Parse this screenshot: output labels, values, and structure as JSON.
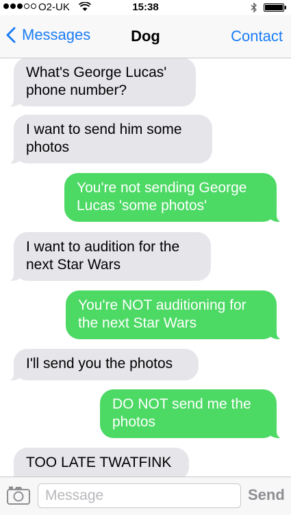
{
  "status_bar": {
    "carrier": "O2-UK",
    "time": "15:38",
    "signal_bars_filled": 3,
    "signal_bars_total": 5,
    "icons": [
      "wifi-icon",
      "bluetooth-icon",
      "battery-icon"
    ]
  },
  "nav": {
    "back_label": "Messages",
    "title": "Dog",
    "contact_label": "Contact"
  },
  "messages": [
    {
      "direction": "incoming",
      "text": "What's George Lucas' phone number?"
    },
    {
      "direction": "incoming",
      "text": "I want to send him some photos"
    },
    {
      "direction": "outgoing",
      "text": "You're not sending George Lucas 'some photos'"
    },
    {
      "direction": "incoming",
      "text": "I want to audition for the next Star Wars"
    },
    {
      "direction": "outgoing",
      "text": "You're NOT auditioning for the next Star Wars"
    },
    {
      "direction": "incoming",
      "text": "I'll send you the photos"
    },
    {
      "direction": "outgoing",
      "text": "DO NOT send me the photos"
    },
    {
      "direction": "incoming",
      "text": "TOO LATE TWATFINK"
    }
  ],
  "composer": {
    "placeholder": "Message",
    "send_label": "Send"
  },
  "colors": {
    "accent": "#1a7cf5",
    "outgoing_bubble": "#4cd964",
    "incoming_bubble": "#e5e5ea",
    "send_disabled": "#8e8e93"
  }
}
